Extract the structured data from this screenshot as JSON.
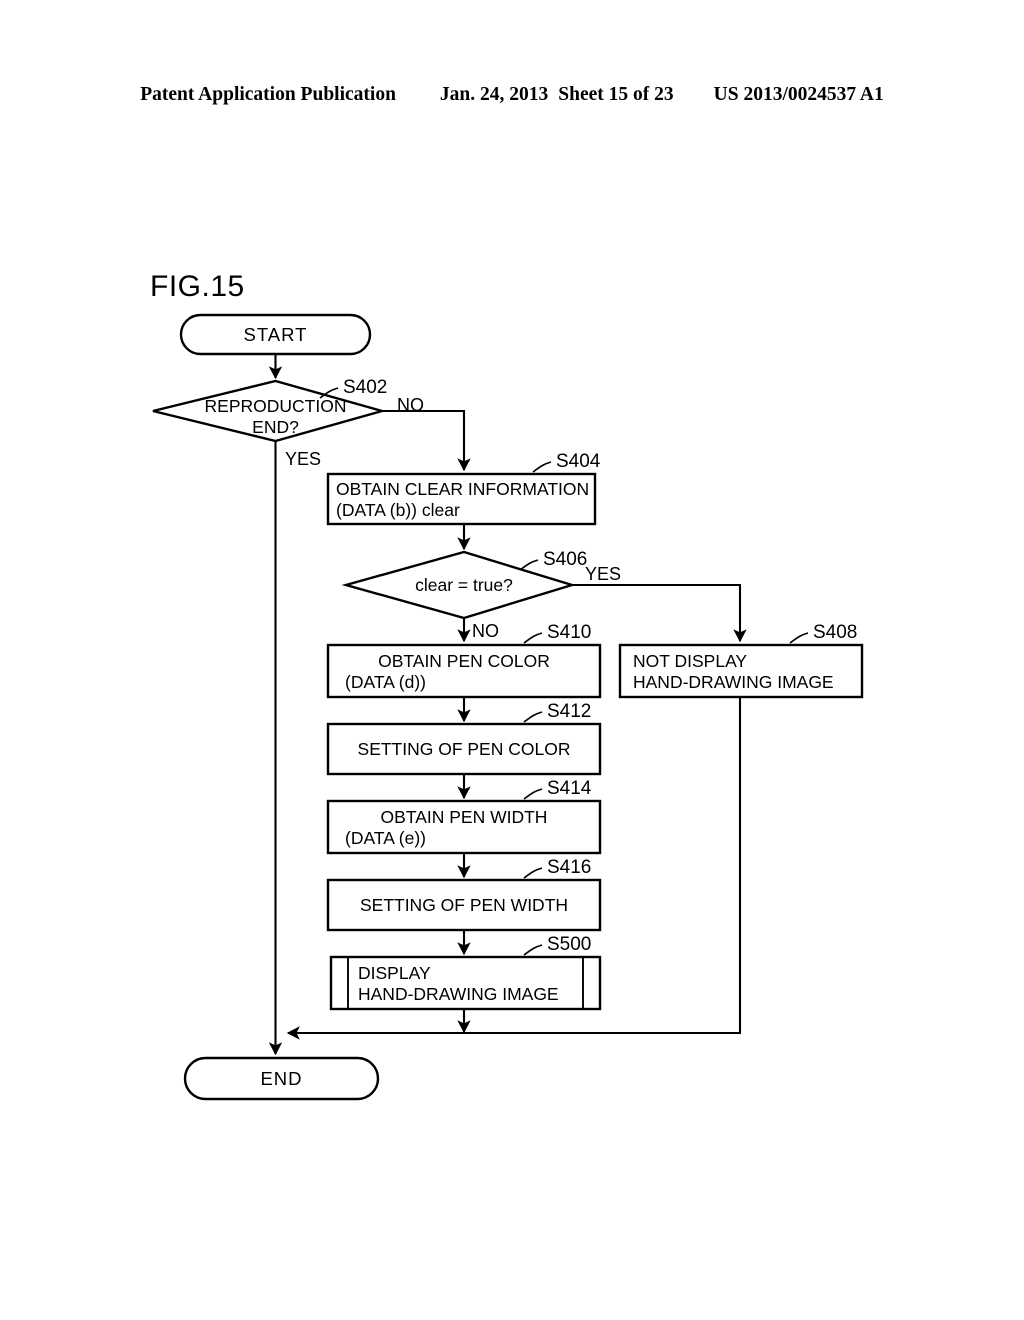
{
  "header": {
    "publication": "Patent Application Publication",
    "date": "Jan. 24, 2013",
    "sheet": "Sheet 15 of 23",
    "docnum": "US 2013/0024537 A1"
  },
  "figure": {
    "title": "FIG.15"
  },
  "chart_data": {
    "type": "diagram",
    "title": "FIG.15",
    "diagram_kind": "flowchart",
    "nodes": [
      {
        "id": "start",
        "shape": "terminator",
        "label": "START",
        "step": ""
      },
      {
        "id": "s402",
        "shape": "decision",
        "label": "REPRODUCTION\nEND?",
        "step": "S402"
      },
      {
        "id": "s404",
        "shape": "process",
        "label": "OBTAIN CLEAR INFORMATION\n(DATA (b)) clear",
        "step": "S404"
      },
      {
        "id": "s406",
        "shape": "decision",
        "label": "clear = true?",
        "step": "S406"
      },
      {
        "id": "s408",
        "shape": "process",
        "label": "NOT DISPLAY\nHAND-DRAWING IMAGE",
        "step": "S408"
      },
      {
        "id": "s410",
        "shape": "process",
        "label": "OBTAIN PEN COLOR\n(DATA (d))",
        "step": "S410"
      },
      {
        "id": "s412",
        "shape": "process",
        "label": "SETTING OF PEN COLOR",
        "step": "S412"
      },
      {
        "id": "s414",
        "shape": "process",
        "label": "OBTAIN PEN WIDTH\n(DATA (e))",
        "step": "S414"
      },
      {
        "id": "s416",
        "shape": "process",
        "label": "SETTING OF PEN WIDTH",
        "step": "S416"
      },
      {
        "id": "s500",
        "shape": "predefined-process",
        "label": "DISPLAY\nHAND-DRAWING IMAGE",
        "step": "S500"
      },
      {
        "id": "end",
        "shape": "terminator",
        "label": "END",
        "step": ""
      }
    ],
    "edges": [
      {
        "from": "start",
        "to": "s402",
        "label": ""
      },
      {
        "from": "s402",
        "to": "s404",
        "label": "NO"
      },
      {
        "from": "s402",
        "to": "end",
        "label": "YES"
      },
      {
        "from": "s404",
        "to": "s406",
        "label": ""
      },
      {
        "from": "s406",
        "to": "s408",
        "label": "YES"
      },
      {
        "from": "s406",
        "to": "s410",
        "label": "NO"
      },
      {
        "from": "s410",
        "to": "s412",
        "label": ""
      },
      {
        "from": "s412",
        "to": "s414",
        "label": ""
      },
      {
        "from": "s414",
        "to": "s416",
        "label": ""
      },
      {
        "from": "s416",
        "to": "s500",
        "label": ""
      },
      {
        "from": "s500",
        "to": "end",
        "label": ""
      },
      {
        "from": "s408",
        "to": "end",
        "label": ""
      }
    ]
  },
  "nodes": {
    "start_label": "START",
    "s402_l1": "REPRODUCTION",
    "s402_l2": "END?",
    "s402_step": "S402",
    "s404_l1": "OBTAIN CLEAR INFORMATION",
    "s404_l2": "(DATA (b)) clear",
    "s404_step": "S404",
    "s406_l1": "clear = true?",
    "s406_step": "S406",
    "s408_l1": "NOT DISPLAY",
    "s408_l2": "HAND-DRAWING IMAGE",
    "s408_step": "S408",
    "s410_l1": "OBTAIN PEN COLOR",
    "s410_l2": "(DATA (d))",
    "s410_step": "S410",
    "s412_l1": "SETTING OF PEN COLOR",
    "s412_step": "S412",
    "s414_l1": "OBTAIN PEN WIDTH",
    "s414_l2": "(DATA (e))",
    "s414_step": "S414",
    "s416_l1": "SETTING OF PEN WIDTH",
    "s416_step": "S416",
    "s500_l1": "DISPLAY",
    "s500_l2": "HAND-DRAWING IMAGE",
    "s500_step": "S500",
    "end_label": "END"
  },
  "branches": {
    "s402_no": "NO",
    "s402_yes": "YES",
    "s406_yes": "YES",
    "s406_no": "NO"
  },
  "colors": {
    "ink": "#000000",
    "paper": "#ffffff"
  }
}
